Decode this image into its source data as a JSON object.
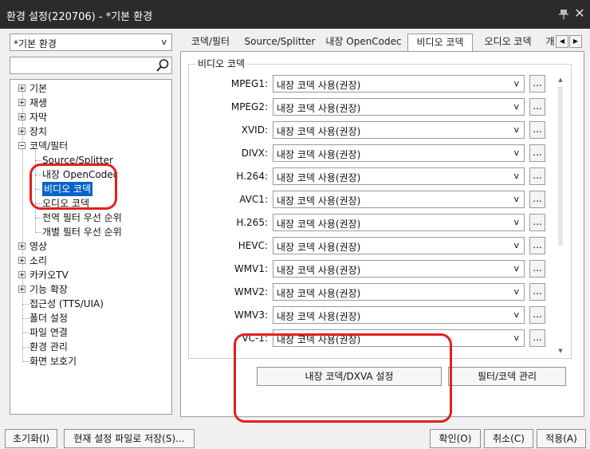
{
  "window": {
    "title": "환경 설정(220706) - *기본 환경",
    "close_glyph": "✕"
  },
  "profile": {
    "value": "*기본 환경",
    "caret": "v"
  },
  "search": {
    "value": ""
  },
  "tree": [
    {
      "label": "기본",
      "indent": 0,
      "expander": "plus",
      "selected": false
    },
    {
      "label": "재생",
      "indent": 0,
      "expander": "plus",
      "selected": false
    },
    {
      "label": "자막",
      "indent": 0,
      "expander": "plus",
      "selected": false
    },
    {
      "label": "장치",
      "indent": 0,
      "expander": "plus",
      "selected": false
    },
    {
      "label": "코덱/필터",
      "indent": 0,
      "expander": "minus",
      "selected": false
    },
    {
      "label": "Source/Splitter",
      "indent": 1,
      "expander": "none",
      "selected": false
    },
    {
      "label": "내장 OpenCodec",
      "indent": 1,
      "expander": "none",
      "selected": false
    },
    {
      "label": "비디오 코덱",
      "indent": 1,
      "expander": "none",
      "selected": true
    },
    {
      "label": "오디오 코덱",
      "indent": 1,
      "expander": "none",
      "selected": false
    },
    {
      "label": "전역 필터 우선 순위",
      "indent": 1,
      "expander": "none",
      "selected": false
    },
    {
      "label": "개별 필터 우선 순위",
      "indent": 1,
      "expander": "none",
      "selected": false
    },
    {
      "label": "영상",
      "indent": 0,
      "expander": "plus",
      "selected": false
    },
    {
      "label": "소리",
      "indent": 0,
      "expander": "plus",
      "selected": false
    },
    {
      "label": "카카오TV",
      "indent": 0,
      "expander": "plus",
      "selected": false
    },
    {
      "label": "기능 확장",
      "indent": 0,
      "expander": "plus",
      "selected": false
    },
    {
      "label": "접근성 (TTS/UIA)",
      "indent": 0,
      "expander": "none",
      "selected": false
    },
    {
      "label": "폴더 설정",
      "indent": 0,
      "expander": "none",
      "selected": false
    },
    {
      "label": "파일 연결",
      "indent": 0,
      "expander": "none",
      "selected": false
    },
    {
      "label": "환경 관리",
      "indent": 0,
      "expander": "none",
      "selected": false
    },
    {
      "label": "화면 보호기",
      "indent": 0,
      "expander": "none",
      "selected": false
    }
  ],
  "tabs": [
    {
      "label": "코덱/필터",
      "active": false
    },
    {
      "label": "Source/Splitter",
      "active": false
    },
    {
      "label": "내장 OpenCodec",
      "active": false
    },
    {
      "label": "비디오 코덱",
      "active": true
    },
    {
      "label": "오디오 코덱",
      "active": false
    },
    {
      "label": "개",
      "active": false
    }
  ],
  "tab_scroll": {
    "left": "◀",
    "right": "▶"
  },
  "group_title": "비디오 코덱",
  "codecs": [
    {
      "label": "MPEG1:",
      "value": "내장 코덱 사용(권장)"
    },
    {
      "label": "MPEG2:",
      "value": "내장 코덱 사용(권장)"
    },
    {
      "label": "XVID:",
      "value": "내장 코덱 사용(권장)"
    },
    {
      "label": "DIVX:",
      "value": "내장 코덱 사용(권장)"
    },
    {
      "label": "H.264:",
      "value": "내장 코덱 사용(권장)"
    },
    {
      "label": "AVC1:",
      "value": "내장 코덱 사용(권장)"
    },
    {
      "label": "H.265:",
      "value": "내장 코덱 사용(권장)"
    },
    {
      "label": "HEVC:",
      "value": "내장 코덱 사용(권장)"
    },
    {
      "label": "WMV1:",
      "value": "내장 코덱 사용(권장)"
    },
    {
      "label": "WMV2:",
      "value": "내장 코덱 사용(권장)"
    },
    {
      "label": "WMV3:",
      "value": "내장 코덱 사용(권장)"
    },
    {
      "label": "VC-1:",
      "value": "내장 코덱 사용(권장)"
    }
  ],
  "select_caret": "v",
  "more_label": "...",
  "scroll_glyphs": {
    "up": "▲",
    "down": "▼"
  },
  "buttons": {
    "dxva": "내장 코덱/DXVA 설정",
    "filter_manage": "필터/코덱 관리",
    "reset": "초기화(I)",
    "save_file": "현재 설정 파일로 저장(S)...",
    "ok": "확인(O)",
    "cancel": "취소(C)",
    "apply": "적용(A)"
  },
  "colors": {
    "titlebar": "#2b2b2b",
    "selection": "#0a64c8",
    "annotation": "#e02020"
  }
}
